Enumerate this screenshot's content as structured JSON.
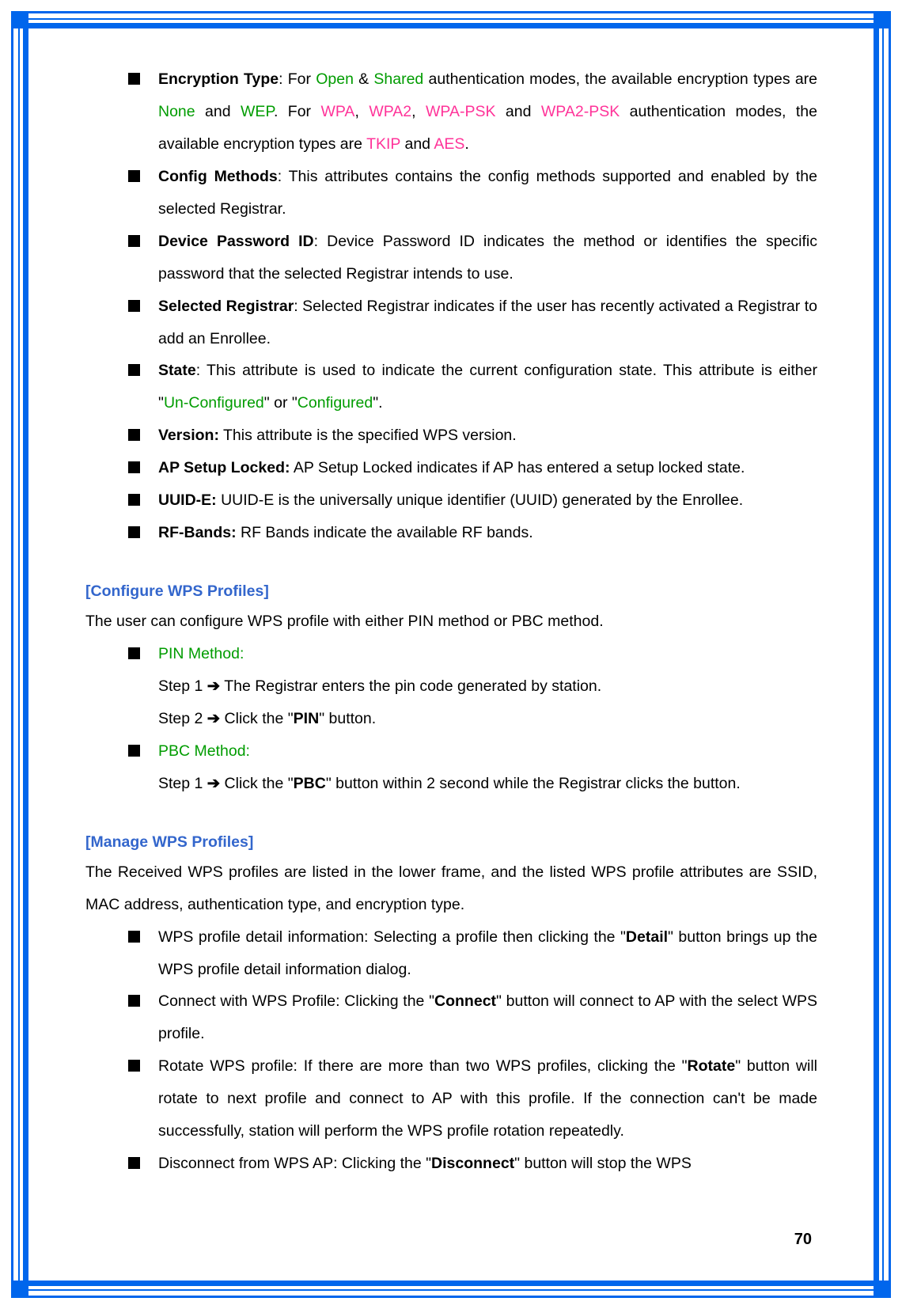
{
  "items_top": [
    {
      "term": "Encryption Type",
      "pre": ": For ",
      "g1": "Open",
      "mid1": " & ",
      "g2": "Shared",
      "mid2": " authentication modes, the available encryption types are ",
      "g3": "None",
      "mid3": " and ",
      "g4": "WEP",
      "mid4": ".   For ",
      "p1": "WPA",
      "c1": ", ",
      "p2": "WPA2",
      "c2": ", ",
      "p3": "WPA-PSK",
      "c3": " and ",
      "p4": "WPA2-PSK",
      "tail1": " authentication modes, the available encryption types are ",
      "p5": "TKIP",
      "c4": " and ",
      "p6": "AES",
      "tail2": "."
    },
    {
      "term": "Config Methods",
      "desc": ": This attributes contains the config methods supported and enabled by the selected Registrar."
    },
    {
      "term": "Device Password ID",
      "desc": ": Device Password ID indicates the method or identifies the specific password that the selected Registrar intends to use."
    },
    {
      "term": "Selected Registrar",
      "desc": ": Selected Registrar indicates if the user has recently activated a Registrar to add an Enrollee."
    },
    {
      "term": "State",
      "pre2": ": This attribute is used to indicate the current configuration state. This attribute is either \"",
      "sg1": "Un-Configured",
      "smid": "\" or \"",
      "sg2": "Configured",
      "stail": "\"."
    },
    {
      "term": "Version:",
      "desc": " This attribute is the specified WPS version."
    },
    {
      "term": "AP Setup Locked:",
      "desc": " AP Setup Locked indicates if AP has entered a setup locked state."
    },
    {
      "term": "UUID-E:",
      "desc": " UUID-E is the universally unique identifier (UUID) generated by the Enrollee."
    },
    {
      "term": "RF-Bands:",
      "desc": " RF Bands indicate the available RF bands."
    }
  ],
  "section1": {
    "head": "[Configure WPS Profiles]",
    "intro": "The user can configure WPS profile with either PIN method or PBC method.",
    "pin_label": "PIN Method:",
    "pin_step1_a": "Step 1 ",
    "pin_step1_b": " The Registrar enters the pin code generated by station.",
    "pin_step2_a": "Step 2 ",
    "pin_step2_b": " Click the \"",
    "pin_step2_btn": "PIN",
    "pin_step2_c": "\" button.",
    "pbc_label": "PBC Method:",
    "pbc_step1_a": "Step 1 ",
    "pbc_step1_b": " Click the \"",
    "pbc_step1_btn": "PBC",
    "pbc_step1_c": "\" button within 2 second while the Registrar clicks the button."
  },
  "section2": {
    "head": "[Manage WPS Profiles]",
    "intro": "The Received WPS profiles are listed in the lower frame, and the listed WPS profile attributes are SSID, MAC address, authentication type, and encryption type.",
    "items": [
      {
        "pre": "WPS profile detail information: Selecting a profile then clicking the \"",
        "btn": "Detail",
        "post": "\" button brings up the WPS profile detail information dialog."
      },
      {
        "pre": "Connect with WPS Profile: Clicking the \"",
        "btn": "Connect",
        "post": "\" button will connect to AP with the select WPS profile."
      },
      {
        "pre": "Rotate WPS profile: If there are more than two WPS profiles, clicking the \"",
        "btn": "Rotate",
        "post": "\" button will rotate to next profile and connect to AP with this profile. If the connection can't be made successfully, station will perform the WPS profile rotation repeatedly."
      },
      {
        "pre": "Disconnect from WPS AP: Clicking the \"",
        "btn": "Disconnect",
        "post": "\" button will stop the WPS"
      }
    ]
  },
  "page_number": "70"
}
